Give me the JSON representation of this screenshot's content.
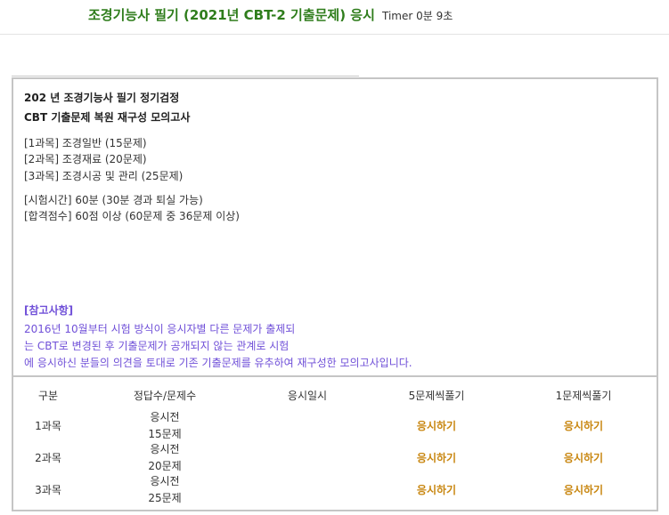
{
  "header": {
    "title": "조경기능사 필기 (2021년 CBT-2 기출문제) 응시",
    "timer": "Timer 0분 9초"
  },
  "info": {
    "heading1": "202  년 조경기능사 필기 정기검정",
    "heading2": "CBT 기출문제 복원 재구성 모의고사",
    "subjects": [
      "[1과목] 조경일반 (15문제)",
      "[2과목] 조경재료 (20문제)",
      "[3과목] 조경시공 및 관리 (25문제)"
    ],
    "exam_time": "[시험시간] 60분 (30분 경과 퇴실 가능)",
    "pass_score": "[합격점수] 60점 이상 (60문제 중 36문제 이상)",
    "notice_title": "[참고사항]",
    "notice_lines": [
      "2016년 10월부터 시험 방식이 응시자별 다른 문제가 출제되",
      "는 CBT로 변경된 후 기출문제가 공개되지 않는 관계로 시험",
      "에 응시하신 분들의 의견을 토대로 기존 기출문제를 유추하여 재구성한 모의고사입니다."
    ]
  },
  "table": {
    "headers": [
      "구분",
      "정답수/문제수",
      "응시일시",
      "5문제씩풀기",
      "1문제씩풀기"
    ],
    "rows": [
      {
        "subject": "1과목",
        "status": "응시전",
        "count": "15문제",
        "five": "응시하기",
        "one": "응시하기"
      },
      {
        "subject": "2과목",
        "status": "응시전",
        "count": "20문제",
        "five": "응시하기",
        "one": "응시하기"
      },
      {
        "subject": "3과목",
        "status": "응시전",
        "count": "25문제",
        "five": "응시하기",
        "one": "응시하기"
      }
    ]
  },
  "colors": {
    "title_green": "#2f7d1c",
    "notice_purple": "#7050d8",
    "start_orange": "#c8860f"
  }
}
